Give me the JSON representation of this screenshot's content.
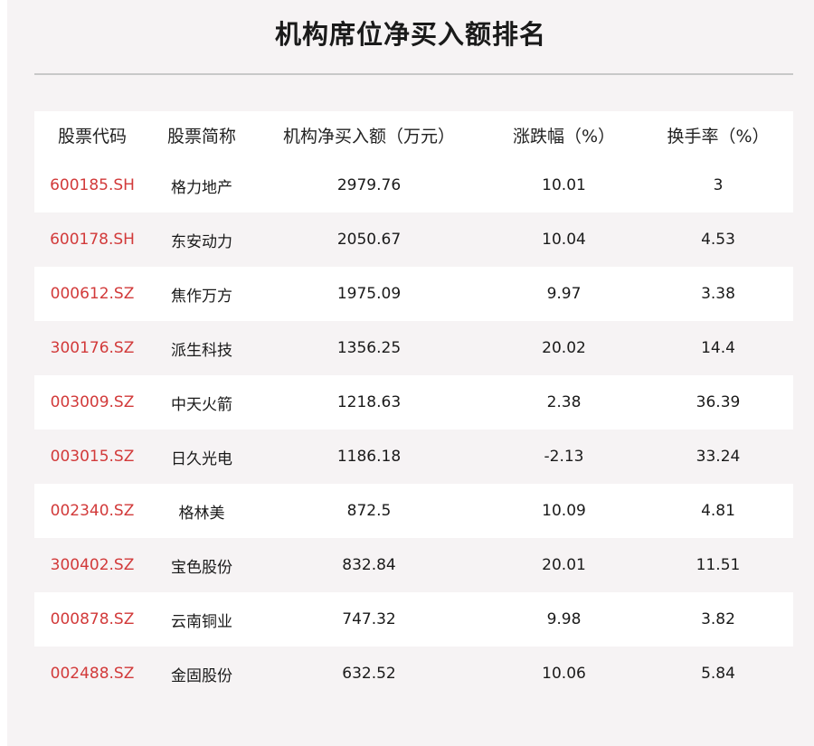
{
  "title": "机构席位净买入额排名",
  "colors": {
    "code": "#d23a3a",
    "text": "#1a1a1a",
    "panel_bg": "#f6f3f4",
    "row_bg": "#ffffff",
    "rule": "#c8c8c8"
  },
  "table": {
    "headers": [
      "股票代码",
      "股票简称",
      "机构净买入额（万元）",
      "涨跌幅（%）",
      "换手率（%）"
    ],
    "rows": [
      [
        "600185.SH",
        "格力地产",
        "2979.76",
        "10.01",
        "3"
      ],
      [
        "600178.SH",
        "东安动力",
        "2050.67",
        "10.04",
        "4.53"
      ],
      [
        "000612.SZ",
        "焦作万方",
        "1975.09",
        "9.97",
        "3.38"
      ],
      [
        "300176.SZ",
        "派生科技",
        "1356.25",
        "20.02",
        "14.4"
      ],
      [
        "003009.SZ",
        "中天火箭",
        "1218.63",
        "2.38",
        "36.39"
      ],
      [
        "003015.SZ",
        "日久光电",
        "1186.18",
        "-2.13",
        "33.24"
      ],
      [
        "002340.SZ",
        "格林美",
        "872.5",
        "10.09",
        "4.81"
      ],
      [
        "300402.SZ",
        "宝色股份",
        "832.84",
        "20.01",
        "11.51"
      ],
      [
        "000878.SZ",
        "云南铜业",
        "747.32",
        "9.98",
        "3.82"
      ],
      [
        "002488.SZ",
        "金固股份",
        "632.52",
        "10.06",
        "5.84"
      ]
    ]
  }
}
